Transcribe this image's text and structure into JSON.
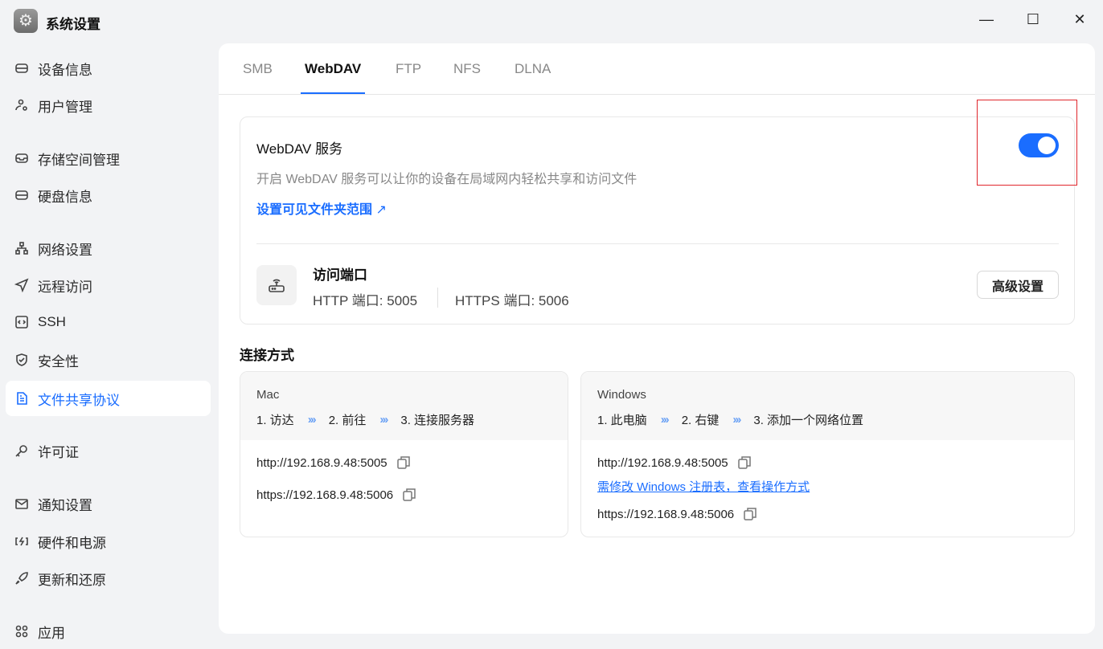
{
  "app": {
    "title": "系统设置",
    "icon": "gear-icon"
  },
  "window": {
    "minimize": "—",
    "maximize": "☐",
    "close": "✕"
  },
  "sidebar": {
    "items": [
      {
        "label": "设备信息",
        "icon": "drive-icon"
      },
      {
        "label": "用户管理",
        "icon": "user-gear-icon"
      },
      {
        "label": "存储空间管理",
        "icon": "inbox-icon"
      },
      {
        "label": "硬盘信息",
        "icon": "drive-icon"
      },
      {
        "label": "网络设置",
        "icon": "network-icon"
      },
      {
        "label": "远程访问",
        "icon": "send-icon"
      },
      {
        "label": "SSH",
        "icon": "code-icon"
      },
      {
        "label": "安全性",
        "icon": "shield-icon"
      },
      {
        "label": "文件共享协议",
        "icon": "document-icon"
      },
      {
        "label": "许可证",
        "icon": "key-icon"
      },
      {
        "label": "通知设置",
        "icon": "mail-icon"
      },
      {
        "label": "硬件和电源",
        "icon": "power-icon"
      },
      {
        "label": "更新和还原",
        "icon": "rocket-icon"
      },
      {
        "label": "应用",
        "icon": "apps-icon"
      }
    ],
    "active": "文件共享协议"
  },
  "tabs": [
    {
      "label": "SMB"
    },
    {
      "label": "WebDAV"
    },
    {
      "label": "FTP"
    },
    {
      "label": "NFS"
    },
    {
      "label": "DLNA"
    }
  ],
  "active_tab": "WebDAV",
  "service": {
    "title": "WebDAV 服务",
    "description": "开启 WebDAV 服务可以让你的设备在局域网内轻松共享和访问文件",
    "link": "设置可见文件夹范围",
    "enabled": true,
    "accent": "#1a6dff"
  },
  "ports": {
    "title": "访问端口",
    "http": "HTTP 端口: 5005",
    "https": "HTTPS 端口: 5006",
    "advanced": "高级设置"
  },
  "connection": {
    "title": "连接方式",
    "mac": {
      "os": "Mac",
      "steps": [
        "1. 访达",
        "2. 前往",
        "3. 连接服务器"
      ],
      "http": "http://192.168.9.48:5005",
      "https": "https://192.168.9.48:5006"
    },
    "windows": {
      "os": "Windows",
      "steps": [
        "1. 此电脑",
        "2. 右键",
        "3. 添加一个网络位置"
      ],
      "http": "http://192.168.9.48:5005",
      "note": "需修改 Windows 注册表，查看操作方式",
      "https": "https://192.168.9.48:5006"
    },
    "arrow": "›››"
  }
}
